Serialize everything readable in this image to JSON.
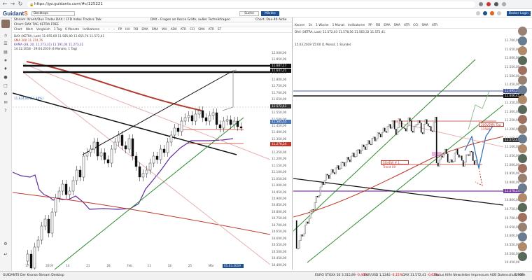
{
  "browser": {
    "url": "https://go.guidants.com/#c/125221"
  },
  "app": {
    "logo_main": "Guidant",
    "logo_accent": "S",
    "desktop": "Desktops",
    "search": "Suche",
    "markets": "Märkte",
    "broker": "Broker Login"
  },
  "left": {
    "stream_title": "Stream: Kronh/Dux Trader DAX / CFD Index Traders Talk",
    "stream_title2": "DAX - Fragen an Rocco Gräfe, außer Technikfragen",
    "stream_title3": "Chart: Dax-40 Aktie",
    "chart_title": "Chart: DAX TAG XETRA FREE",
    "toolbar": [
      "Chart",
      "Wert",
      "Vergleich",
      "1 Tag",
      "6 Monate",
      "Indikatoren",
      "–",
      "–",
      "–",
      "PP",
      "HH",
      "FIB",
      "EMA",
      "SMA",
      "WH",
      "ADX",
      "ATR",
      "CCI",
      "SMA",
      "ATR",
      "ST"
    ],
    "legend1": "DAX (XETRA, Last) 11.655,69 11.585,90 11.655,74 11.572,41",
    "legend2": "SMA 200 11.374,76",
    "legend3": "KAMA (28, 20, 11.273,31) 11.191,04 11.273,31",
    "legend4": "14.12.2018 - 29.04.2019 (4 Monate, 1 Tag)",
    "hline_label": "11.624,80 (61.40%)",
    "price_tags": [
      "11.687,17",
      "11.647,21",
      "11.572,41",
      "11.585,55",
      "11.278,24"
    ],
    "y_ticks": [
      "12.000,00",
      "11.950,00",
      "11.900,00",
      "11.850,00",
      "11.800,00",
      "11.750,00",
      "11.700,00",
      "11.650,00",
      "11.600,00",
      "11.550,00",
      "11.500,00",
      "11.450,00",
      "11.400,00",
      "11.350,00",
      "11.300,00",
      "11.250,00",
      "11.200,00",
      "11.150,00",
      "11.100,00",
      "11.050,00",
      "11.000,00",
      "10.950,00",
      "10.900,00",
      "10.850,00",
      "10.800,00",
      "10.750,00",
      "10.700,00",
      "10.650,00",
      "10.600,00",
      "10.550,00",
      "10.500,00",
      "10.450,00",
      "10.400,00"
    ],
    "x_ticks": [
      "17",
      "2019",
      "14",
      "21",
      "28",
      "Feb",
      "11",
      "18",
      "25",
      "Mär",
      "11"
    ],
    "date_tag": "05.03.2019"
  },
  "right": {
    "toolbar": [
      "Kerzen",
      "1h",
      "1 Woche",
      "1 Monat",
      "Indikatoren",
      "PP",
      "FIB",
      "EMA",
      "SMA",
      "ATR",
      "CCI",
      "SMA",
      "ATR"
    ],
    "legend1": "DAX (XETRA, Last) 11.572,03 11.578,56 11.563,32 11.572,41",
    "legend2": "15.03.2019 15:00 (1 Monat, 1 Stunde)",
    "y_ticks": [
      "11.700,00",
      "11.650,00",
      "11.600,00",
      "11.550,00",
      "11.500,00",
      "11.450,00",
      "11.400,00",
      "11.350,00",
      "11.300,00",
      "11.250,00",
      "11.200,00",
      "11.150,00",
      "11.100,00",
      "11.050,00",
      "11.000,00",
      "10.950,00",
      "10.900,00",
      "10.850,00",
      "10.800,00",
      "10.750,00",
      "10.700,00",
      "10.650,00",
      "10.600,00",
      "10.550,00",
      "10.500,00",
      "10.450,00"
    ],
    "tags": [
      "11.695,29",
      "11.606,45",
      "11.572,41",
      "11.278,24"
    ],
    "box_labels": [
      "200VSMA Tag 11580",
      "SSHEW # 1 Trend XX"
    ]
  },
  "status": {
    "stream": "GUIDANTS Der Kronos-Stream Desktop",
    "tickers": [
      {
        "t": "EURO STOXX 50",
        "v": "3.315,89",
        "c": "-0,46%",
        "neg": true
      },
      {
        "t": "EUR/USD",
        "v": "1,1240",
        "c": "-0,15%",
        "neg": true
      },
      {
        "t": "DAX",
        "v": "11.572,41",
        "c": "-0,62%",
        "neg": true
      }
    ],
    "links": "Status  Hilfe  Newsletter  Impressum  AGB  Datenschutz  Hilfe",
    "count": "7.906"
  }
}
